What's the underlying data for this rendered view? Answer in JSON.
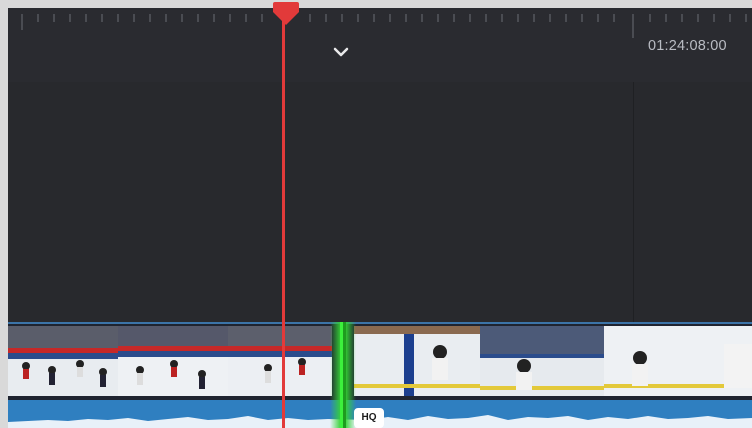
{
  "timeline": {
    "timecode": "01:24:08:00",
    "ruler_icon": "chevron-down-icon"
  },
  "badges": {
    "hq": "HQ"
  },
  "colors": {
    "playhead": "#e23a3a",
    "edit_point": "#35d335",
    "audio": "#2f7fc0",
    "video_border": "#3c74a8",
    "background": "#26272b"
  },
  "icons": [
    "playhead-icon",
    "chevron-down-icon"
  ]
}
